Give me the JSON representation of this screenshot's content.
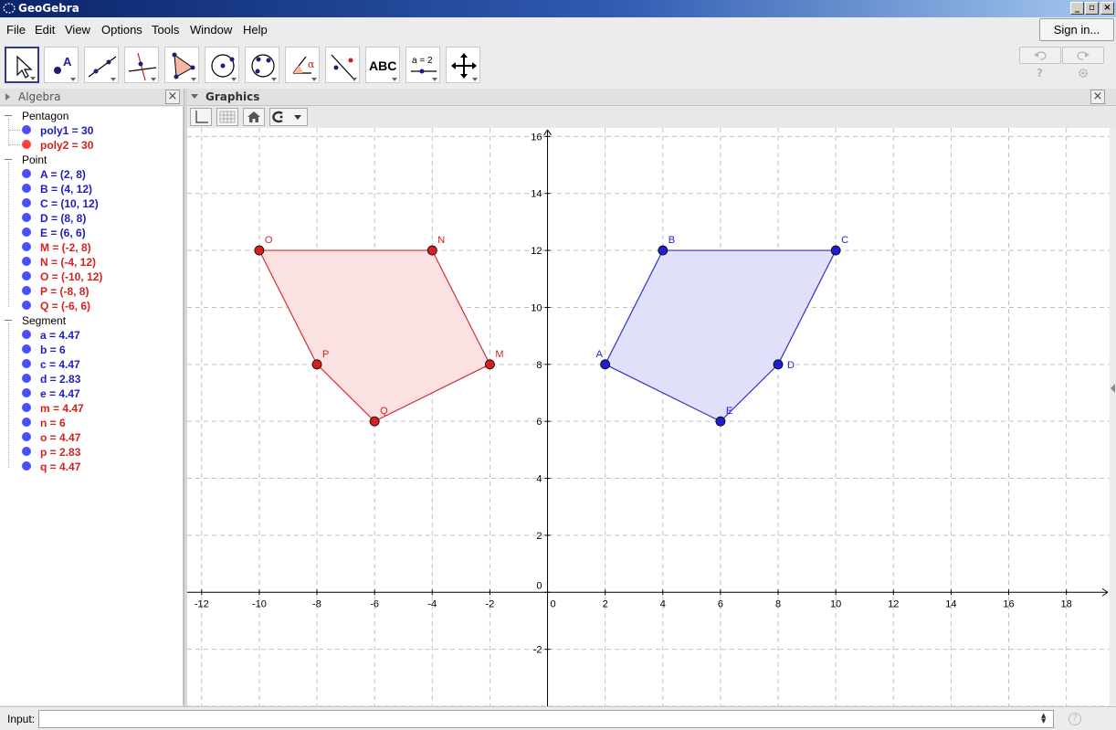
{
  "window": {
    "title": "GeoGebra",
    "controls": [
      "_",
      "▫",
      "×"
    ]
  },
  "menu": [
    "File",
    "Edit",
    "View",
    "Options",
    "Tools",
    "Window",
    "Help"
  ],
  "signin_label": "Sign in...",
  "toolbar": {
    "tools": [
      {
        "name": "move-tool",
        "icon": "arrow-cursor-icon"
      },
      {
        "name": "point-tool",
        "icon": "point-icon",
        "text": "A"
      },
      {
        "name": "line-tool",
        "icon": "line-icon"
      },
      {
        "name": "perpendicular-tool",
        "icon": "perpendicular-line-icon"
      },
      {
        "name": "polygon-tool",
        "icon": "polygon-icon"
      },
      {
        "name": "circle-center-tool",
        "icon": "circle-center-icon"
      },
      {
        "name": "circle-three-points-tool",
        "icon": "circle-three-points-icon"
      },
      {
        "name": "angle-tool",
        "icon": "angle-icon",
        "text": "α"
      },
      {
        "name": "reflect-tool",
        "icon": "reflect-icon"
      },
      {
        "name": "text-tool",
        "icon": "text-icon",
        "text": "ABC"
      },
      {
        "name": "slider-tool",
        "icon": "slider-icon",
        "text": "a = 2"
      },
      {
        "name": "move-view-tool",
        "icon": "move-graphics-icon"
      }
    ],
    "undo_icon": "undo-icon",
    "redo_icon": "redo-icon",
    "help_glyph": "?",
    "settings_icon": "gear-icon"
  },
  "algebra": {
    "title": "Algebra",
    "categories": [
      {
        "label": "Pentagon",
        "items": [
          {
            "text": "poly1 = 30",
            "color": "blue"
          },
          {
            "text": "poly2 = 30",
            "color": "red"
          }
        ]
      },
      {
        "label": "Point",
        "items": [
          {
            "text": "A = (2, 8)",
            "color": "blue"
          },
          {
            "text": "B = (4, 12)",
            "color": "blue"
          },
          {
            "text": "C = (10, 12)",
            "color": "blue"
          },
          {
            "text": "D = (8, 8)",
            "color": "blue"
          },
          {
            "text": "E = (6, 6)",
            "color": "blue"
          },
          {
            "text": "M = (-2, 8)",
            "color": "red"
          },
          {
            "text": "N = (-4, 12)",
            "color": "red"
          },
          {
            "text": "O = (-10, 12)",
            "color": "red"
          },
          {
            "text": "P = (-8, 8)",
            "color": "red"
          },
          {
            "text": "Q = (-6, 6)",
            "color": "red"
          }
        ]
      },
      {
        "label": "Segment",
        "items": [
          {
            "text": "a = 4.47",
            "color": "blue"
          },
          {
            "text": "b = 6",
            "color": "blue"
          },
          {
            "text": "c = 4.47",
            "color": "blue"
          },
          {
            "text": "d = 2.83",
            "color": "blue"
          },
          {
            "text": "e = 4.47",
            "color": "blue"
          },
          {
            "text": "m = 4.47",
            "color": "red"
          },
          {
            "text": "n = 6",
            "color": "red"
          },
          {
            "text": "o = 4.47",
            "color": "red"
          },
          {
            "text": "p = 2.83",
            "color": "red"
          },
          {
            "text": "q = 4.47",
            "color": "red"
          }
        ]
      }
    ]
  },
  "graphics": {
    "title": "Graphics",
    "style_tools": [
      "axes-toggle-icon",
      "grid-toggle-icon",
      "home-icon",
      "point-capture-icon"
    ],
    "x_range": [
      -12.5,
      19.5
    ],
    "y_range": [
      -4,
      16.3
    ],
    "x_ticks": [
      -12,
      -10,
      -8,
      -6,
      -4,
      -2,
      0,
      2,
      4,
      6,
      8,
      10,
      12,
      14,
      16,
      18
    ],
    "y_ticks": [
      -2,
      0,
      2,
      4,
      6,
      8,
      10,
      12,
      14,
      16
    ],
    "grid": true,
    "polygons": [
      {
        "name": "poly1",
        "vertices": [
          "A",
          "B",
          "C",
          "D",
          "E"
        ],
        "stroke": "#3131c8",
        "fill": "#e0e0fb"
      },
      {
        "name": "poly2",
        "vertices": [
          "M",
          "N",
          "O",
          "P",
          "Q"
        ],
        "stroke": "#d63030",
        "fill": "#fbe1e1"
      }
    ],
    "points": [
      {
        "label": "A",
        "x": 2,
        "y": 8,
        "color": "#2020d0",
        "label_pos": "upper-left"
      },
      {
        "label": "B",
        "x": 4,
        "y": 12,
        "color": "#2020d0",
        "label_pos": "upper-right"
      },
      {
        "label": "C",
        "x": 10,
        "y": 12,
        "color": "#2020d0",
        "label_pos": "upper-right"
      },
      {
        "label": "D",
        "x": 8,
        "y": 8,
        "color": "#2020d0",
        "label_pos": "right"
      },
      {
        "label": "E",
        "x": 6,
        "y": 6,
        "color": "#2020d0",
        "label_pos": "upper-right"
      },
      {
        "label": "M",
        "x": -2,
        "y": 8,
        "color": "#d62020",
        "label_pos": "upper-right"
      },
      {
        "label": "N",
        "x": -4,
        "y": 12,
        "color": "#d62020",
        "label_pos": "upper-right"
      },
      {
        "label": "O",
        "x": -10,
        "y": 12,
        "color": "#d62020",
        "label_pos": "upper-right"
      },
      {
        "label": "P",
        "x": -8,
        "y": 8,
        "color": "#d62020",
        "label_pos": "upper-right"
      },
      {
        "label": "Q",
        "x": -6,
        "y": 6,
        "color": "#d62020",
        "label_pos": "upper-right"
      }
    ]
  },
  "input": {
    "label": "Input:",
    "value": "",
    "help_glyph": "?"
  }
}
